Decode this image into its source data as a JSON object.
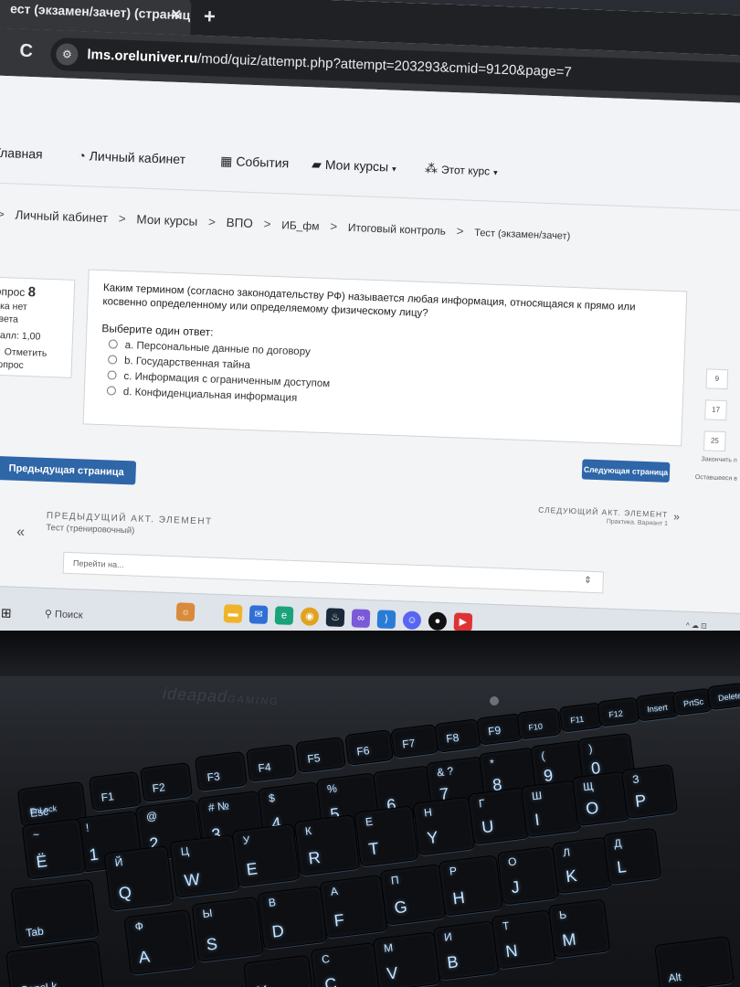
{
  "browser": {
    "tab_title": "ест (экзамен/зачет) (страниц",
    "tab_close": "✕",
    "new_tab": "+",
    "reload": "C",
    "site_icon": "⚙",
    "url_domain": "lms.oreluniver.ru",
    "url_path": "/mod/quiz/attempt.php?attempt=203293&cmid=9120&page=7"
  },
  "nav": {
    "home": "Главная",
    "cabinet": "Личный кабинет",
    "events": "События",
    "my_courses": "Мои курсы",
    "this_course": "Этот курс",
    "caret": "▾"
  },
  "breadcrumb": [
    "Личный кабинет",
    "Мои курсы",
    "ВПО",
    "ИБ_фм",
    "Итоговый контроль",
    "Тест (экзамен/зачет)"
  ],
  "breadcrumb_sep": ">",
  "question_info": {
    "label": "опрос",
    "number": "8",
    "status_line1": "ока нет",
    "status_line2": "твета",
    "score": "Балл: 1,00",
    "flag_line1": "Отметить",
    "flag_line2": "вопрос"
  },
  "question": {
    "text": "Каким термином (согласно законодательству РФ) называется любая информация, относящаяся к прямо или косвенно определенному или определяемому физическому лицу?",
    "prompt": "Выберите один ответ:",
    "options": [
      "a. Персональные данные по договору",
      "b. Государственная тайна",
      "c. Информация с ограниченным доступом",
      "d. Конфиденциальная информация"
    ]
  },
  "quiz_nav": {
    "numbers": [
      "9",
      "17",
      "25"
    ],
    "finish": "Закончить п",
    "remaining": "Оставшееся в"
  },
  "buttons": {
    "next_page": "Следующая страница",
    "prev_page": "Предыдущая страница"
  },
  "activity": {
    "next_label": "СЛЕДУЮЩИЙ АКТ. ЭЛЕМЕНТ",
    "next_name": "Практика. Вариант 1",
    "next_arrow": "»",
    "prev_label": "ПРЕДЫДУЩИЙ АКТ. ЭЛЕМЕНТ",
    "prev_name": "Тест (тренировочный)",
    "prev_arrow": "«",
    "jump_placeholder": "Перейти на...",
    "jump_caret": "⇕"
  },
  "taskbar": {
    "search": "Поиск",
    "tray": "^ ☁ ⊡"
  },
  "laptop": {
    "brand": "ideapad",
    "brand_sub": "GAMING"
  },
  "keys": [
    {
      "id": "esc",
      "main": "Esc",
      "sub": "FnLock"
    },
    {
      "id": "f1",
      "main": "F1",
      "sub": ""
    },
    {
      "id": "f2",
      "main": "F2",
      "sub": ""
    },
    {
      "id": "f3",
      "main": "F3",
      "sub": ""
    },
    {
      "id": "f4",
      "main": "F4",
      "sub": ""
    },
    {
      "id": "f5",
      "main": "F5",
      "sub": ""
    },
    {
      "id": "f6",
      "main": "F6",
      "sub": ""
    },
    {
      "id": "f7",
      "main": "F7",
      "sub": ""
    },
    {
      "id": "f8",
      "main": "F8",
      "sub": ""
    },
    {
      "id": "f9",
      "main": "F9",
      "sub": ""
    },
    {
      "id": "f10",
      "main": "F10",
      "sub": ""
    },
    {
      "id": "f11",
      "main": "F11",
      "sub": ""
    },
    {
      "id": "f12",
      "main": "F12",
      "sub": ""
    },
    {
      "id": "insert",
      "main": "Insert",
      "sub": ""
    },
    {
      "id": "prtsc",
      "main": "PrtSc",
      "sub": ""
    },
    {
      "id": "delete",
      "main": "Delete",
      "sub": ""
    },
    {
      "id": "k1",
      "main": "1",
      "sub": "!"
    },
    {
      "id": "k2",
      "main": "2",
      "sub": "@"
    },
    {
      "id": "k3",
      "main": "3",
      "sub": "#  №"
    },
    {
      "id": "k4",
      "main": "4",
      "sub": "$"
    },
    {
      "id": "k5",
      "main": "5",
      "sub": "%"
    },
    {
      "id": "k6",
      "main": "6",
      "sub": ""
    },
    {
      "id": "k7",
      "main": "7",
      "sub": "&  ?"
    },
    {
      "id": "k8",
      "main": "8",
      "sub": "*"
    },
    {
      "id": "k9",
      "main": "9",
      "sub": "("
    },
    {
      "id": "k0",
      "main": "0",
      "sub": ")"
    },
    {
      "id": "tilde",
      "main": "Ё",
      "sub": "~"
    },
    {
      "id": "kq",
      "main": "Q",
      "sub": "Й"
    },
    {
      "id": "kw",
      "main": "W",
      "sub": "Ц"
    },
    {
      "id": "ke",
      "main": "E",
      "sub": "У"
    },
    {
      "id": "kr",
      "main": "R",
      "sub": "К"
    },
    {
      "id": "kt",
      "main": "T",
      "sub": "Е"
    },
    {
      "id": "ky",
      "main": "Y",
      "sub": "Н"
    },
    {
      "id": "ku",
      "main": "U",
      "sub": "Г"
    },
    {
      "id": "ki",
      "main": "I",
      "sub": "Ш"
    },
    {
      "id": "ko",
      "main": "O",
      "sub": "Щ"
    },
    {
      "id": "kp",
      "main": "P",
      "sub": "З"
    },
    {
      "id": "tab",
      "main": "Tab",
      "sub": ""
    },
    {
      "id": "ka",
      "main": "A",
      "sub": "Ф"
    },
    {
      "id": "ks",
      "main": "S",
      "sub": "Ы"
    },
    {
      "id": "kd",
      "main": "D",
      "sub": "В"
    },
    {
      "id": "kf",
      "main": "F",
      "sub": "А"
    },
    {
      "id": "kg",
      "main": "G",
      "sub": "П"
    },
    {
      "id": "kh",
      "main": "H",
      "sub": "Р"
    },
    {
      "id": "kj",
      "main": "J",
      "sub": "О"
    },
    {
      "id": "kk",
      "main": "K",
      "sub": "Л"
    },
    {
      "id": "kl",
      "main": "L",
      "sub": "Д"
    },
    {
      "id": "capslk",
      "main": "CapsLk",
      "sub": ""
    },
    {
      "id": "kx",
      "main": "X",
      "sub": ""
    },
    {
      "id": "kc",
      "main": "C",
      "sub": "С"
    },
    {
      "id": "kv",
      "main": "V",
      "sub": "М"
    },
    {
      "id": "kb",
      "main": "B",
      "sub": "И"
    },
    {
      "id": "kn",
      "main": "N",
      "sub": "Т"
    },
    {
      "id": "km",
      "main": "M",
      "sub": "Ь"
    },
    {
      "id": "alt",
      "main": "Alt",
      "sub": ""
    }
  ]
}
